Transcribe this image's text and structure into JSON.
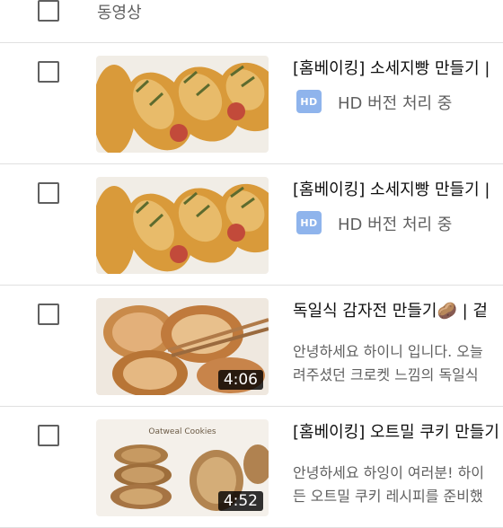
{
  "header": {
    "label": "동영상"
  },
  "videos": [
    {
      "title": "[홈베이킹] 소세지빵 만들기 |",
      "status": "HD 버전 처리 중",
      "hd_badge": "HD",
      "thumbnail": "sausage-bread-thumbnail"
    },
    {
      "title": "[홈베이킹] 소세지빵 만들기 |",
      "status": "HD 버전 처리 중",
      "hd_badge": "HD",
      "thumbnail": "sausage-bread-thumbnail"
    },
    {
      "title": "독일식 감자전 만들기🥔 | 겉",
      "desc1": "안녕하세요 하이니 입니다. 오늘",
      "desc2": "려주셨던 크로켓 느낌의 독일식",
      "duration": "4:06",
      "thumbnail": "potato-pancake-thumbnail"
    },
    {
      "title": "[홈베이킹] 오트밀 쿠키 만들기",
      "desc1": "안녕하세요 하잉이 여러분! 하이",
      "desc2": "든 오트밀 쿠키 레시피를 준비했",
      "duration": "4:52",
      "thumb_text": "Oatweal Cookies",
      "thumbnail": "oatmeal-cookie-thumbnail"
    }
  ],
  "colors": {
    "hd_badge": "#8fb4ec",
    "secondary_text": "#606060",
    "divider": "#e0e0e0"
  }
}
